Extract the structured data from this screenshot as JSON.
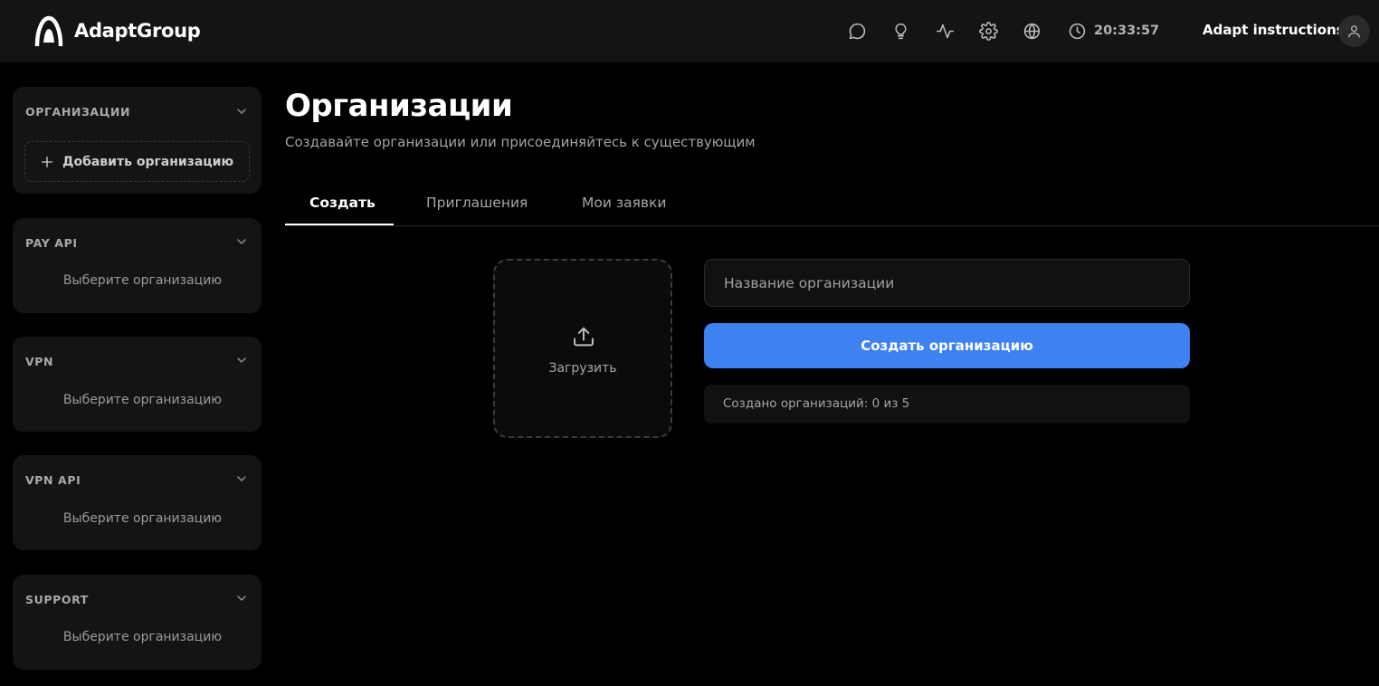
{
  "app": {
    "logo_text": "AdaptGroup"
  },
  "header": {
    "icons": [
      "chat-icon",
      "lightbulb-icon",
      "activity-icon",
      "gear-icon",
      "globe-icon"
    ],
    "time": "20:33:57",
    "user_name": "Adapt instructions"
  },
  "sidebar": {
    "organizations": {
      "title": "ОРГАНИЗАЦИИ",
      "add_label": "Добавить организацию"
    },
    "sections": [
      {
        "title": "PAY API",
        "empty": "Выберите организацию"
      },
      {
        "title": "VPN",
        "empty": "Выберите организацию"
      },
      {
        "title": "VPN API",
        "empty": "Выберите организацию"
      },
      {
        "title": "SUPPORT",
        "empty": "Выберите организацию"
      }
    ]
  },
  "main": {
    "title": "Организации",
    "subtitle": "Создавайте организации или присоединяйтесь к существующим",
    "tabs": [
      {
        "label": "Создать",
        "active": true
      },
      {
        "label": "Приглашения",
        "active": false
      },
      {
        "label": "Мои заявки",
        "active": false
      }
    ],
    "upload_label": "Загрузить",
    "name_placeholder": "Название организации",
    "create_button": "Создать организацию",
    "counter_text": "Создано организаций: 0 из 5"
  },
  "colors": {
    "accent": "#3d82f0",
    "background": "#000000",
    "card": "#141414"
  }
}
